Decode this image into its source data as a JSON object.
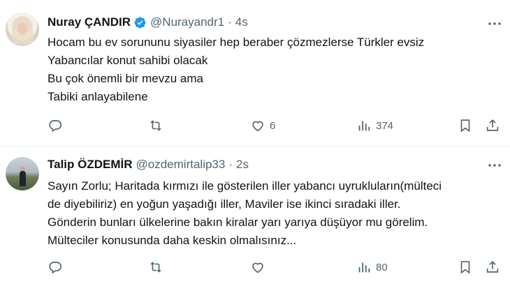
{
  "tweets": [
    {
      "display_name": "Nuray ÇANDIR",
      "handle": "@Nurayandr1",
      "separator": "·",
      "time": "4s",
      "verified": true,
      "lines": [
        "Hocam bu ev sorununu siyasiler hep beraber çözmezlerse Türkler evsiz",
        "Yabancılar konut sahibi olacak",
        "Bu çok önemli bir mevzu ama",
        "Tabiki anlayabilene"
      ],
      "actions": {
        "replies": "",
        "retweets": "",
        "likes": "6",
        "views": "374"
      }
    },
    {
      "display_name": "Talip ÖZDEMİR",
      "handle": "@ozdemirtalip33",
      "separator": "·",
      "time": "2s",
      "verified": false,
      "lines": [
        "Sayın Zorlu; Haritada kırmızı ile gösterilen iller yabancı uyrukluların(mülteci",
        "de diyebiliriz) en yoğun yaşadığı iller, Maviler ise ikinci sıradaki iller.",
        "Gönderin bunları ülkelerine bakın kiralar yarı yarıya düşüyor mu görelim.",
        "Mülteciler konusunda daha keskin olmalısınız..."
      ],
      "actions": {
        "replies": "",
        "retweets": "",
        "likes": "",
        "views": "80"
      }
    }
  ],
  "colors": {
    "text": "#0f1419",
    "muted": "#536471",
    "verified": "#1d9bf0",
    "divider": "#eff3f4"
  },
  "icons": [
    "verified-badge-icon",
    "more-icon",
    "reply-icon",
    "retweet-icon",
    "like-icon",
    "views-icon",
    "bookmark-icon",
    "share-icon"
  ]
}
